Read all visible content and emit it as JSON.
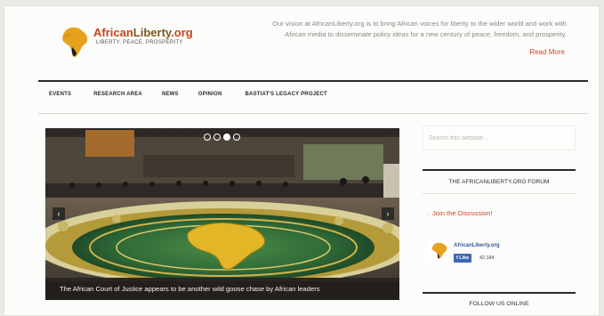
{
  "header": {
    "logo_main": "African",
    "logo_accent": "Liberty",
    "logo_suffix": ".org",
    "tagline": "LIBERTY. PEACE. PROSPERITY",
    "vision_line1": "Our vision at AfricanLiberty.org is to bring African voices for liberty to the wider world and work with",
    "vision_line2": "African media to disseminate policy ideas for a new century of peace, freedom, and prosperity.",
    "read_more": "Read More"
  },
  "nav": {
    "items": [
      {
        "label": "EVENTS"
      },
      {
        "label": "RESEARCH AREA"
      },
      {
        "label": "NEWS"
      },
      {
        "label": "OPINION"
      },
      {
        "label": "BASTIAT'S LEGACY PROJECT"
      }
    ]
  },
  "slider": {
    "caption": "The African Court of Justice appears to be another wild goose chase by African leaders",
    "slide_count": 4,
    "active_slide": 3,
    "prev_glyph": "‹",
    "next_glyph": "›"
  },
  "sidebar": {
    "search_placeholder": "Search this website...",
    "forum_title": "THE AFRICANLIBERTY.ORG FORUM",
    "join_link": "Join the Discussion!",
    "fb_page_name": "AfricanLiberty.org",
    "fb_like_label": "Like",
    "fb_like_count": "42,184",
    "follow_title": "FOLLOW US ONLINE"
  },
  "colors": {
    "accent_red": "#d5492a",
    "logo_gold": "#e6a21d",
    "facebook_blue": "#4267b2",
    "hall_green": "#2f6b38"
  }
}
